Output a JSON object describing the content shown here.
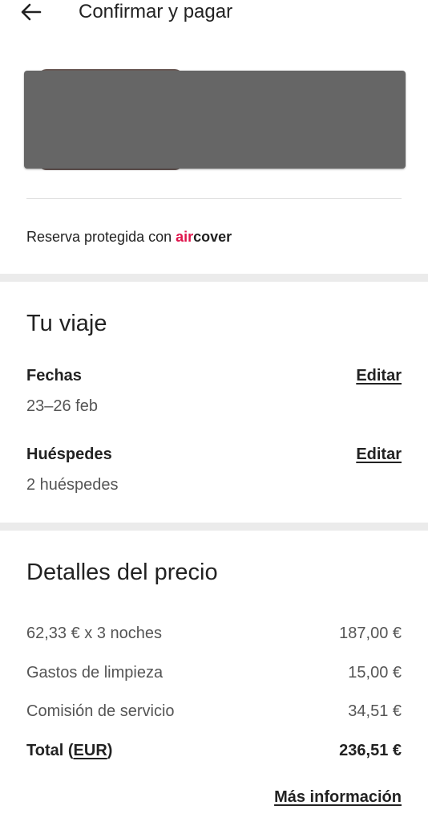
{
  "header": {
    "title": "Confirmar y pagar",
    "back_icon": "arrow-left-icon"
  },
  "protection": {
    "prefix": "Reserva protegida con ",
    "brand_air": "air",
    "brand_cover": "cover",
    "brand_color": "#e0144c"
  },
  "trip": {
    "title": "Tu viaje",
    "dates_label": "Fechas",
    "dates_value": "23–26 feb",
    "dates_edit": "Editar",
    "guests_label": "Huéspedes",
    "guests_value": "2 huéspedes",
    "guests_edit": "Editar"
  },
  "price": {
    "title": "Detalles del precio",
    "rows": [
      {
        "label": "62,33 € x 3 noches",
        "value": "187,00 €"
      },
      {
        "label": "Gastos de limpieza",
        "value": "15,00 €"
      },
      {
        "label": "Comisión de servicio",
        "value": "34,51 €"
      }
    ],
    "total_label": "Total ",
    "total_open": "(",
    "total_currency": "EUR",
    "total_close": ")",
    "total_value": "236,51 €",
    "more_info": "Más información"
  }
}
